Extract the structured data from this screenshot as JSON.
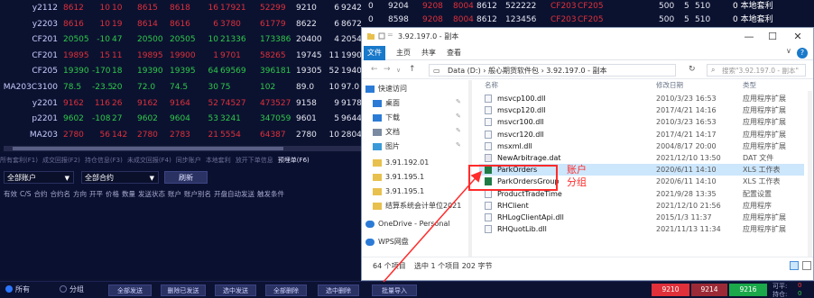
{
  "quotes": [
    {
      "name": "y2112",
      "price": "8612",
      "chg": "10",
      "pct": "10",
      "bid": "8615",
      "ask": "8618",
      "vol": "16",
      "cvol": "17921",
      "oi": "52299",
      "last": "9210",
      "lv": "6",
      "px": "9242",
      "price_color": "red"
    },
    {
      "name": "y2203",
      "price": "8616",
      "chg": "10",
      "pct": "19",
      "bid": "8614",
      "ask": "8616",
      "vol": "6",
      "cvol": "3780",
      "oi": "61779",
      "last": "8622",
      "lv": "6",
      "px": "8672",
      "price_color": "red"
    },
    {
      "name": "CF201",
      "price": "20505",
      "chg": "-10",
      "pct": "47",
      "bid": "20500",
      "ask": "20505",
      "vol": "10",
      "cvol": "21336",
      "oi": "173386",
      "last": "20400",
      "lv": "4",
      "px": "20545",
      "price_color": "green"
    },
    {
      "name": "CF201",
      "price": "19895",
      "chg": "15",
      "pct": "11",
      "bid": "19895",
      "ask": "19900",
      "vol": "1",
      "cvol": "9701",
      "oi": "58265",
      "last": "19745",
      "lv": "11",
      "px": "19905",
      "price_color": "red"
    },
    {
      "name": "CF205",
      "price": "19390",
      "chg": "-170",
      "pct": "18",
      "bid": "19390",
      "ask": "19395",
      "vol": "64",
      "cvol": "69569",
      "oi": "396181",
      "last": "19305",
      "lv": "52",
      "px": "19405",
      "price_color": "green"
    },
    {
      "name": "MA203C3100",
      "price": "78.5",
      "chg": "-23.5",
      "pct": "20",
      "bid": "72.0",
      "ask": "74.5",
      "vol": "30",
      "cvol": "75",
      "oi": "102",
      "last": "89.0",
      "lv": "10",
      "px": "97.0",
      "price_color": "green"
    },
    {
      "name": "y2201",
      "price": "9162",
      "chg": "116",
      "pct": "26",
      "bid": "9162",
      "ask": "9164",
      "vol": "52",
      "cvol": "74527",
      "oi": "473527",
      "last": "9158",
      "lv": "9",
      "px": "9178",
      "price_color": "red"
    },
    {
      "name": "p2201",
      "price": "9602",
      "chg": "-108",
      "pct": "27",
      "bid": "9602",
      "ask": "9604",
      "vol": "53",
      "cvol": "3241",
      "oi": "347059",
      "last": "9601",
      "lv": "5",
      "px": "9644",
      "price_color": "green"
    },
    {
      "name": "MA203",
      "price": "2780",
      "chg": "56",
      "pct": "142",
      "bid": "2780",
      "ask": "2783",
      "vol": "21",
      "cvol": "5554",
      "oi": "64387",
      "last": "2780",
      "lv": "10",
      "px": "2804",
      "price_color": "red"
    }
  ],
  "right_rows": [
    {
      "a": "0",
      "b": "9204",
      "c": "9208",
      "d": "8004",
      "e": "8612",
      "f": "522222",
      "g": "CF203",
      "h": "CF205",
      "i": "500",
      "j": "5",
      "k": "510",
      "l": "0 本地套利"
    },
    {
      "a": "0",
      "b": "8598",
      "c": "9208",
      "d": "8004",
      "e": "8612",
      "f": "123456",
      "g": "CF203",
      "h": "CF205",
      "i": "500",
      "j": "5",
      "k": "510",
      "l": "0 本地套利"
    }
  ],
  "account_panel": {
    "tabs": [
      "所有套利(F1)",
      "成交回报(F2)",
      "持仓信息(F3)",
      "未成交回报(F4)",
      "同步账户",
      "本地套利",
      "放开下单信息",
      "预埋单(F6)"
    ],
    "active_tab": "预埋单(F6)",
    "account_select": "全部账户",
    "contract_select": "全部合约",
    "query_button": "刷新",
    "columns": [
      "有效",
      "C/S",
      "合约",
      "合约名",
      "方向",
      "开平",
      "价格",
      "数量",
      "发送状态",
      "账户",
      "账户别名",
      "开盘自动发送",
      "触发条件"
    ]
  },
  "bottom_bar": {
    "radio_all": "所有",
    "radio_group": "分组",
    "buttons": [
      "全部发送",
      "删除已发送",
      "选中发送",
      "全部删除",
      "选中删除",
      "批量导入"
    ],
    "price_boxes": [
      "9210",
      "9214",
      "9216"
    ],
    "price_colors": [
      "#e0303a",
      "#9c2a36",
      "#1aa84a"
    ],
    "pos_label": "可平:",
    "pos_value": "0",
    "avail_label": "持仓:",
    "avail_value": "0"
  },
  "explorer": {
    "title": "3.92.197.0 - 副本",
    "ribbon_file": "文件",
    "ribbon_tabs": [
      "主页",
      "共享",
      "查看"
    ],
    "address_path": "Data (D:)  ›  般心期货软件包  ›  3.92.197.0 - 副本",
    "search_placeholder": "搜索\"3.92.197.0 - 副本\"",
    "nav_items": [
      {
        "label": "快速访问",
        "icon": "star",
        "pinned": false
      },
      {
        "label": "桌面",
        "icon": "desktop",
        "pinned": true
      },
      {
        "label": "下载",
        "icon": "download",
        "pinned": true
      },
      {
        "label": "文档",
        "icon": "document",
        "pinned": true
      },
      {
        "label": "图片",
        "icon": "picture",
        "pinned": true
      },
      {
        "label": "3.91.192.01",
        "icon": "folder",
        "pinned": false
      },
      {
        "label": "3.91.195.1",
        "icon": "folder",
        "pinned": false
      },
      {
        "label": "3.91.195.1",
        "icon": "folder",
        "pinned": false
      },
      {
        "label": "结算系统会计单位2021",
        "icon": "folder",
        "pinned": false
      },
      {
        "label": "OneDrive - Personal",
        "icon": "cloud",
        "pinned": false
      },
      {
        "label": "WPS网盘",
        "icon": "cloud",
        "pinned": false
      }
    ],
    "columns": {
      "name": "名称",
      "date": "修改日期",
      "type": "类型"
    },
    "files": [
      {
        "name": "msvcp100.dll",
        "date": "2010/3/23 16:53",
        "type": "应用程序扩展",
        "icon": "dll",
        "selected": false
      },
      {
        "name": "msvcp120.dll",
        "date": "2017/4/21 14:16",
        "type": "应用程序扩展",
        "icon": "dll",
        "selected": false
      },
      {
        "name": "msvcr100.dll",
        "date": "2010/3/23 16:53",
        "type": "应用程序扩展",
        "icon": "dll",
        "selected": false
      },
      {
        "name": "msvcr120.dll",
        "date": "2017/4/21 14:17",
        "type": "应用程序扩展",
        "icon": "dll",
        "selected": false
      },
      {
        "name": "msxml.dll",
        "date": "2004/8/17 20:00",
        "type": "应用程序扩展",
        "icon": "dll",
        "selected": false
      },
      {
        "name": "NewArbitrage.dat",
        "date": "2021/12/10 13:50",
        "type": "DAT 文件",
        "icon": "dat",
        "selected": false
      },
      {
        "name": "ParkOrders",
        "date": "2020/6/11 14:10",
        "type": "XLS 工作表",
        "icon": "xls",
        "selected": true
      },
      {
        "name": "ParkOrdersGroup",
        "date": "2020/6/11 14:10",
        "type": "XLS 工作表",
        "icon": "xls",
        "selected": false
      },
      {
        "name": "ProductTradeTime",
        "date": "2021/9/28 13:35",
        "type": "配置设置",
        "icon": "cfg",
        "selected": false
      },
      {
        "name": "RHClient",
        "date": "2021/12/10 21:56",
        "type": "应用程序",
        "icon": "exe",
        "selected": false
      },
      {
        "name": "RHLogClientApi.dll",
        "date": "2015/1/3 11:37",
        "type": "应用程序扩展",
        "icon": "dll",
        "selected": false
      },
      {
        "name": "RHQuotLib.dll",
        "date": "2021/11/13 11:34",
        "type": "应用程序扩展",
        "icon": "dll",
        "selected": false
      }
    ],
    "status_count": "64 个项目",
    "status_selected": "选中 1 个项目  202 字节"
  },
  "annotation": {
    "text": "账户分组",
    "color": "#ff2b2b"
  }
}
